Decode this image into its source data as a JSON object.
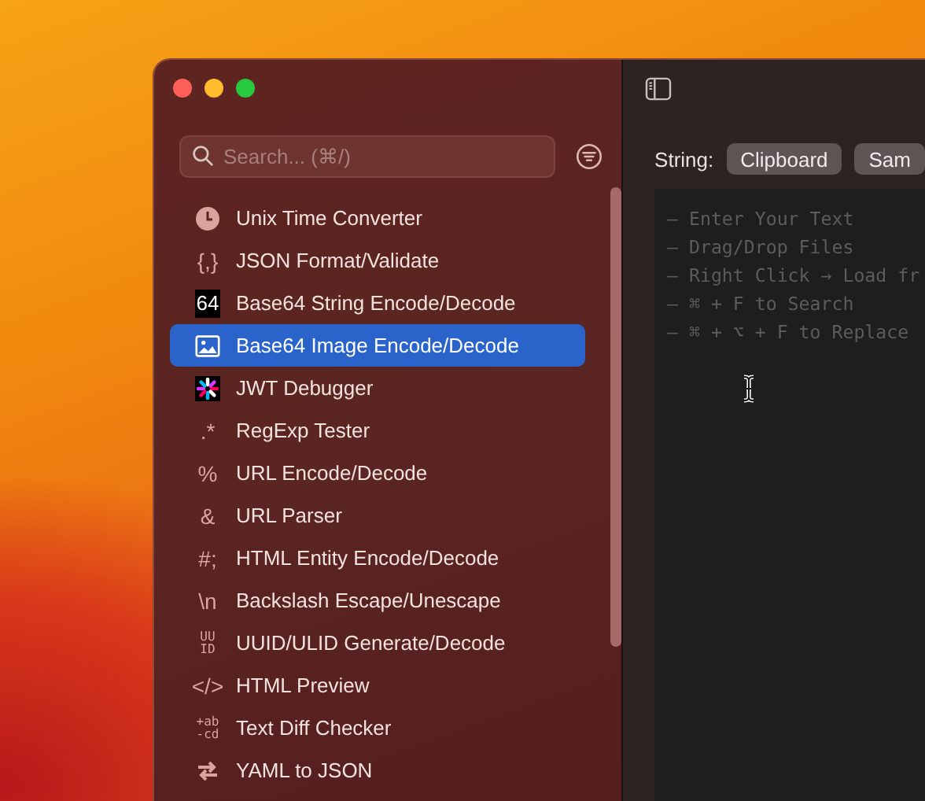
{
  "sidebar": {
    "search": {
      "placeholder": "Search... (⌘/)"
    },
    "items": [
      {
        "kind": "drawing",
        "label": "Unix Time Converter",
        "selected": false
      },
      {
        "kind": "glyph",
        "glyph": "{,}",
        "label": "JSON Format/Validate",
        "selected": false
      },
      {
        "kind": "badge",
        "glyph": "64",
        "label": "Base64 String Encode/Decode",
        "selected": false
      },
      {
        "kind": "drawing",
        "label": "Base64 Image Encode/Decode",
        "selected": true
      },
      {
        "kind": "drawing",
        "label": "JWT Debugger",
        "selected": false
      },
      {
        "kind": "glyph",
        "glyph": ".*",
        "label": "RegExp Tester",
        "selected": false
      },
      {
        "kind": "glyph",
        "glyph": "%",
        "label": "URL Encode/Decode",
        "selected": false
      },
      {
        "kind": "glyph",
        "glyph": "&",
        "label": "URL Parser",
        "selected": false
      },
      {
        "kind": "glyph",
        "glyph": "#;",
        "label": "HTML Entity Encode/Decode",
        "selected": false
      },
      {
        "kind": "glyph",
        "glyph": "\\n",
        "label": "Backslash Escape/Unescape",
        "selected": false
      },
      {
        "kind": "stacked",
        "glyph": [
          "UU",
          "ID"
        ],
        "label": "UUID/ULID Generate/Decode",
        "selected": false
      },
      {
        "kind": "glyph",
        "glyph": "</>",
        "label": "HTML Preview",
        "selected": false
      },
      {
        "kind": "stacked",
        "glyph": [
          "+ab",
          "-cd"
        ],
        "label": "Text Diff Checker",
        "selected": false
      },
      {
        "kind": "drawing",
        "label": "YAML to JSON",
        "selected": false
      }
    ]
  },
  "main": {
    "input_label": "String:",
    "buttons": [
      "Clipboard",
      "Sam"
    ],
    "editor": {
      "placeholder": "— Enter Your Text\n— Drag/Drop Files\n— Right Click → Load fr\n— ⌘ + F to Search\n— ⌘ + ⌥ + F to Replace"
    }
  }
}
